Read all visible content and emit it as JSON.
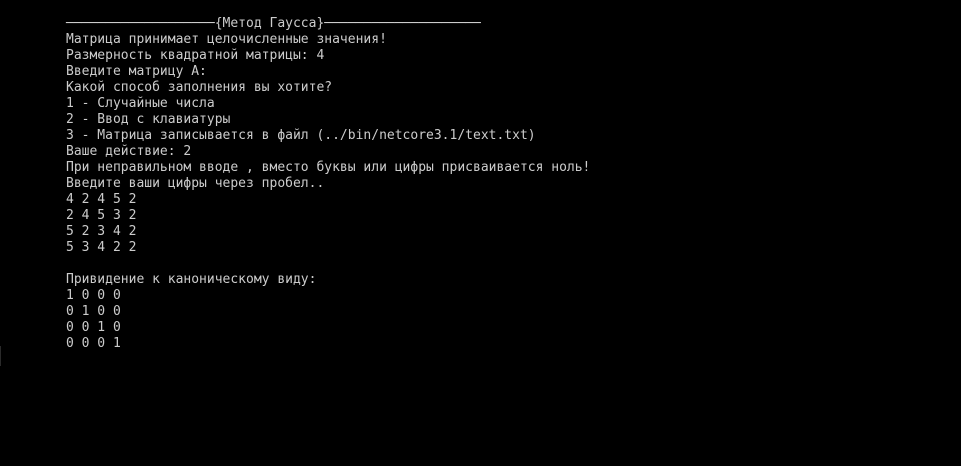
{
  "console": {
    "header": "───────────────────{Метод Гаусса}────────────────────",
    "intro_integer_values": "Матрица принимает целочисленные значения!",
    "matrix_size": "Размерность квадратной матрицы: 4",
    "enter_matrix_prompt": "Введите матрицу A:",
    "fill_method_question": "Какой способ заполнения вы хотите?",
    "menu": [
      "1 - Случайные числа",
      "2 - Ввод с клавиатуры",
      "3 - Матрица записывается в файл (../bin/netcore3.1/text.txt)"
    ],
    "action_prompt": "Ваше действие: 2",
    "input_warning": "При неправильном вводе , вместо буквы или цифры присваивается ноль!",
    "digits_prompt": "Введите ваши цифры через пробел..",
    "input_matrix": [
      "4 2 4 5 2",
      "2 4 5 3 2",
      "5 2 3 4 2",
      "5 3 4 2 2"
    ],
    "blank": "",
    "canonical_title": "Привидение к каноническому виду:",
    "result_matrix": [
      "1 0 0 0",
      "0 1 0 0",
      "0 0 1 0",
      "0 0 0 1"
    ]
  },
  "colors": {
    "background": "#000000",
    "text": "#cccccc"
  }
}
